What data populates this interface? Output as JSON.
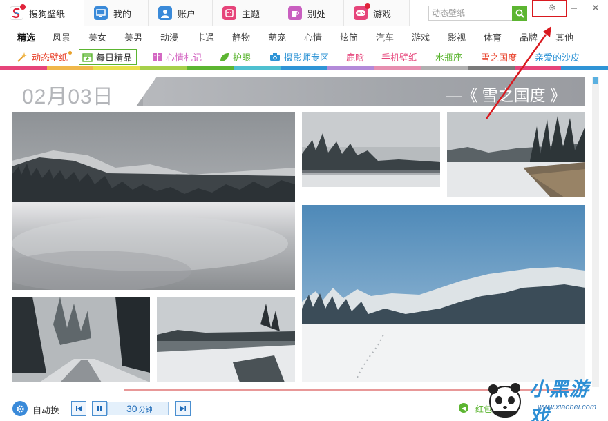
{
  "tabs": [
    {
      "label": "搜狗壁纸",
      "icon": "sogou-logo-icon",
      "color": "#e0233a",
      "has_dot": true,
      "active": true
    },
    {
      "label": "我的",
      "icon": "monitor-icon",
      "color": "#3a8ad9",
      "has_dot": false,
      "active": false
    },
    {
      "label": "账户",
      "icon": "user-icon",
      "color": "#3a8ad9",
      "has_dot": false,
      "active": false
    },
    {
      "label": "主题",
      "icon": "theme-icon",
      "color": "#e6447a",
      "has_dot": false,
      "active": false
    },
    {
      "label": "别处",
      "icon": "cup-icon",
      "color": "#c95fc0",
      "has_dot": false,
      "active": false
    },
    {
      "label": "游戏",
      "icon": "gamepad-icon",
      "color": "#e6447a",
      "has_dot": true,
      "active": false
    }
  ],
  "search": {
    "placeholder": "动态壁纸"
  },
  "categories": [
    {
      "label": "精选",
      "selected": true
    },
    {
      "label": "风景",
      "selected": false
    },
    {
      "label": "美女",
      "selected": false
    },
    {
      "label": "美男",
      "selected": false
    },
    {
      "label": "动漫",
      "selected": false
    },
    {
      "label": "卡通",
      "selected": false
    },
    {
      "label": "静物",
      "selected": false
    },
    {
      "label": "萌宠",
      "selected": false
    },
    {
      "label": "心情",
      "selected": false
    },
    {
      "label": "炫简",
      "selected": false
    },
    {
      "label": "汽车",
      "selected": false
    },
    {
      "label": "游戏",
      "selected": false
    },
    {
      "label": "影视",
      "selected": false
    },
    {
      "label": "体育",
      "selected": false
    },
    {
      "label": "品牌",
      "selected": false
    },
    {
      "label": "其他",
      "selected": false
    }
  ],
  "specials": [
    {
      "label": "动态壁纸",
      "color": "#e8402a",
      "icon": "magic-wand-icon"
    },
    {
      "label": "每日精品",
      "color": "#5cb531",
      "icon": "calendar-star-icon"
    },
    {
      "label": "心情札记",
      "color": "#d468c3",
      "icon": "book-icon"
    },
    {
      "label": "护眼",
      "color": "#5cb531",
      "icon": "leaf-icon"
    },
    {
      "label": "摄影师专区",
      "color": "#2f94d6",
      "icon": "camera-icon"
    },
    {
      "label": "鹿晗",
      "color": "#e6447a",
      "icon": ""
    },
    {
      "label": "手机壁纸",
      "color": "#e6447a",
      "icon": ""
    },
    {
      "label": "水瓶座",
      "color": "#5cb531",
      "icon": ""
    },
    {
      "label": "雪之国度",
      "color": "#e8402a",
      "icon": ""
    },
    {
      "label": "亲爱的沙皮",
      "color": "#2f94d6",
      "icon": ""
    }
  ],
  "colorbar": [
    "#e6447a",
    "#f0b74a",
    "#e8e04a",
    "#a6d04a",
    "#5cb531",
    "#4ec0d0",
    "#2f94d6",
    "#b38ad9",
    "#e68fb0",
    "#b0b0b0",
    "#7a7a7a",
    "#e6447a",
    "#2f94d6"
  ],
  "banner": {
    "date": "02月03日",
    "title": "—《 雪之国度 》"
  },
  "bottom": {
    "auto_label": "自动换",
    "timer_value": "30",
    "timer_unit": "分钟",
    "note": "红包大派送"
  },
  "watermark": {
    "text": "小黑游戏",
    "site": "www.xiaohei.com"
  }
}
